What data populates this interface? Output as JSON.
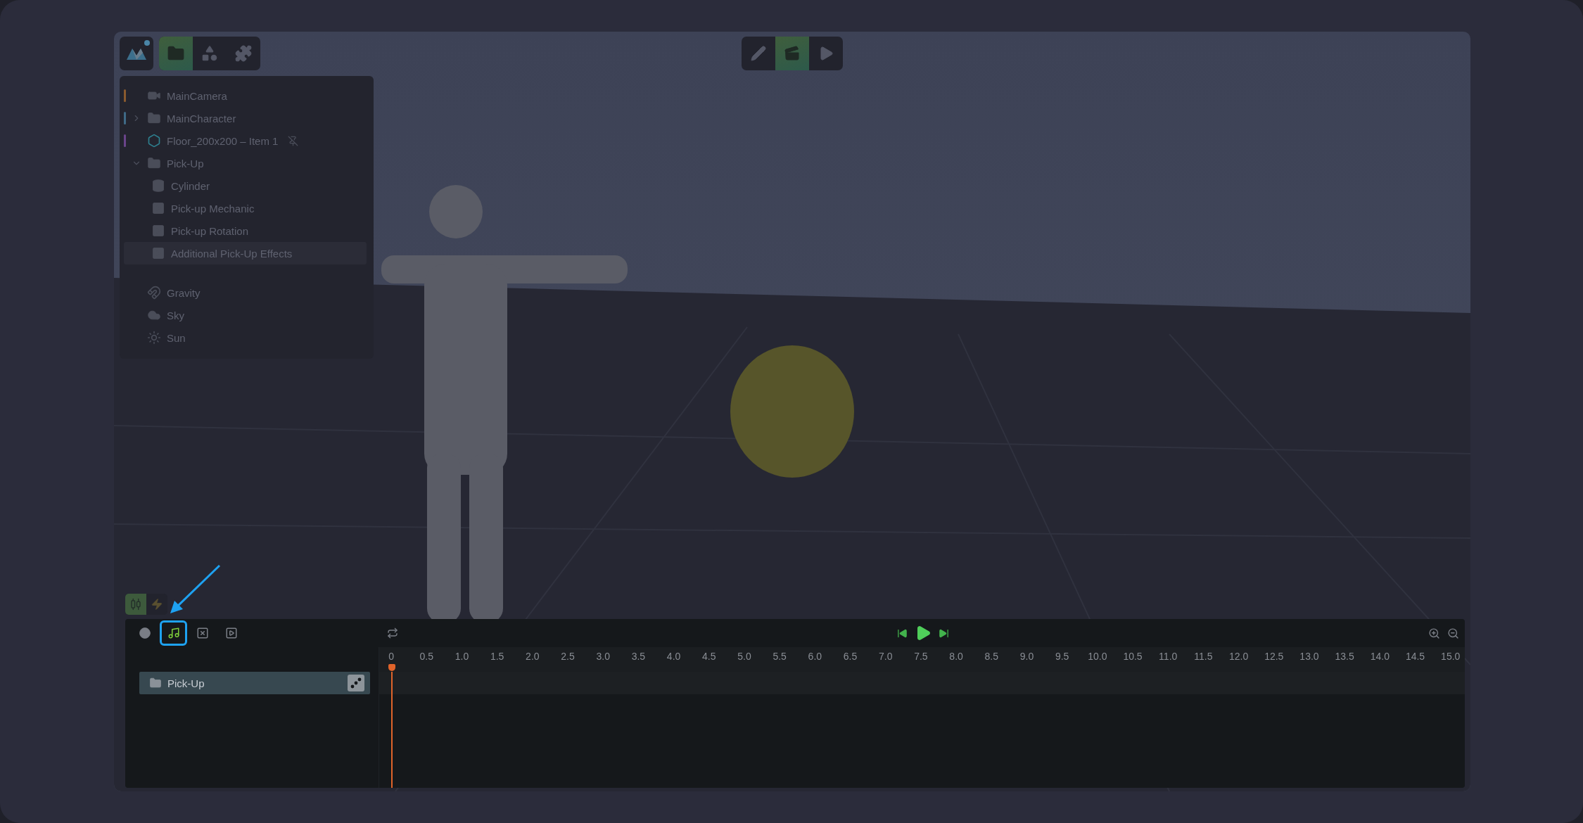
{
  "toolbar_left": {
    "logo": {
      "notification": true
    },
    "tabs": [
      {
        "selected": true
      },
      {
        "selected": false
      },
      {
        "selected": false
      }
    ]
  },
  "toolbar_center": {
    "modes": [
      {
        "selected": false
      },
      {
        "selected": true
      },
      {
        "selected": false
      }
    ]
  },
  "hierarchy": {
    "items": [
      {
        "label": "MainCamera",
        "kind": "camera",
        "color": "#8a5a2e"
      },
      {
        "label": "MainCharacter",
        "kind": "folder",
        "color": "#3f6a86",
        "expanded": false
      },
      {
        "label": "Floor_200x200 – Item 1",
        "kind": "mesh",
        "color": "#6a448a",
        "detached": true
      },
      {
        "label": "Pick-Up",
        "kind": "folder",
        "expanded": true,
        "children": [
          {
            "label": "Cylinder",
            "kind": "cylinder",
            "selected": false
          },
          {
            "label": "Pick-up Mechanic",
            "kind": "script",
            "selected": false
          },
          {
            "label": "Pick-up Rotation",
            "kind": "script",
            "selected": false
          },
          {
            "label": "Additional Pick-Up Effects",
            "kind": "script",
            "selected": true
          }
        ]
      }
    ],
    "environment": [
      {
        "label": "Gravity",
        "kind": "gravity"
      },
      {
        "label": "Sky",
        "kind": "cloud"
      },
      {
        "label": "Sun",
        "kind": "sun"
      }
    ]
  },
  "timeline": {
    "view_modes": [
      {
        "selected": true
      },
      {
        "selected": false
      }
    ],
    "add_buttons": [
      {
        "highlighted": false
      },
      {
        "highlighted": true
      },
      {
        "highlighted": false
      },
      {
        "highlighted": false
      }
    ],
    "ruler": [
      "0",
      "0.5",
      "1.0",
      "1.5",
      "2.0",
      "2.5",
      "3.0",
      "3.5",
      "4.0",
      "4.5",
      "5.0",
      "5.5",
      "6.0",
      "6.5",
      "7.0",
      "7.5",
      "8.0",
      "8.5",
      "9.0",
      "9.5",
      "10.0",
      "10.5",
      "11.0",
      "11.5",
      "12.0",
      "12.5",
      "13.0",
      "13.5",
      "14.0",
      "14.5",
      "15.0"
    ],
    "tracks": [
      {
        "label": "Pick-Up",
        "selected": true
      }
    ]
  }
}
